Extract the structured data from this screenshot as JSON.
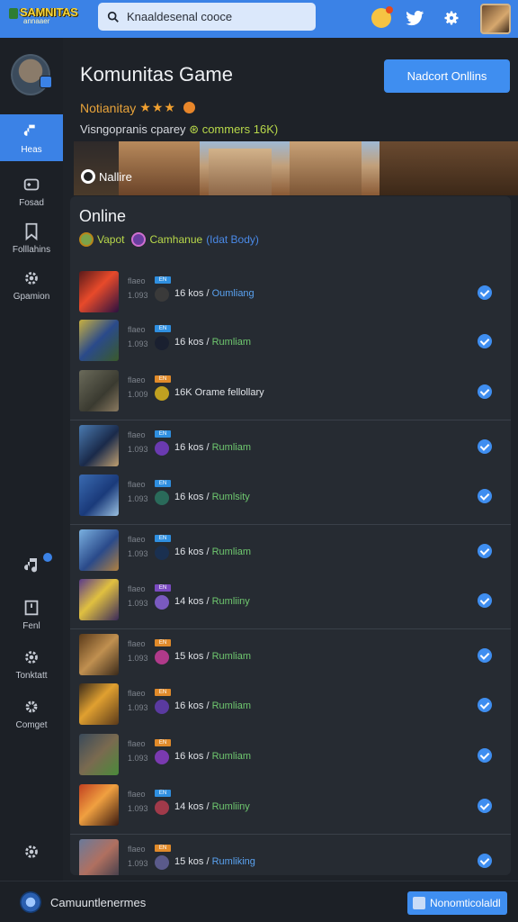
{
  "header": {
    "logo_text": "SAMNITAS",
    "logo_sub": "annaaer",
    "search_placeholder": "Knaaldesenal cooce"
  },
  "sidebar": {
    "items": [
      {
        "label": "Heas",
        "icon": "music-note-icon",
        "active": true
      },
      {
        "label": "Fosad",
        "icon": "controller-icon"
      },
      {
        "label": "Folllahins",
        "icon": "bookmark-icon"
      },
      {
        "label": "Gpamion",
        "icon": "gear-icon"
      },
      {
        "label": "Fenl",
        "icon": "square-icon"
      },
      {
        "label": "Tonktatt",
        "icon": "gear-icon"
      },
      {
        "label": "Comget",
        "icon": "cog-icon"
      }
    ]
  },
  "main": {
    "title": "Komunitas Game",
    "primary_button": "Nadcort Onllins",
    "rating_label": "Notianitay",
    "rating_stars": "★★★",
    "meta_text": "Visngopranis cparey",
    "meta_count": "⊛ commers 16K)",
    "banner_tag": "Nallire",
    "panel_title": "Online",
    "filter_a": "Vapot",
    "filter_b": "Camhanue",
    "filter_c": "(Idat Body)"
  },
  "list": [
    {
      "label": "flaeo",
      "num": "1.093",
      "badge": "EN",
      "badge_color": "#2f8fe0",
      "text": "16 kos /",
      "status": "Oumliang",
      "status_color": "#5aa2f0"
    },
    {
      "label": "flaeo",
      "num": "1.093",
      "badge": "EN",
      "badge_color": "#2f8fe0",
      "text": "16 kos /",
      "status": "Rumliam",
      "status_color": "#6fc86f"
    },
    {
      "label": "flaeo",
      "num": "1.009",
      "badge": "EN",
      "badge_color": "#e08a2a",
      "text": "16K Orame fellollary",
      "status": "",
      "status_color": "#6fc86f"
    },
    {
      "label": "flaeo",
      "num": "1.093",
      "badge": "EN",
      "badge_color": "#2f8fe0",
      "text": "16 kos /",
      "status": "Rumliam",
      "status_color": "#6fc86f"
    },
    {
      "label": "flaeo",
      "num": "1.093",
      "badge": "EN",
      "badge_color": "#2f8fe0",
      "text": "16 kos /",
      "status": "Rumlsity",
      "status_color": "#6fc86f"
    },
    {
      "label": "flaeo",
      "num": "1.093",
      "badge": "EN",
      "badge_color": "#2f8fe0",
      "text": "16 kos /",
      "status": "Rumliam",
      "status_color": "#6fc86f"
    },
    {
      "label": "flaeo",
      "num": "1.093",
      "badge": "EN",
      "badge_color": "#7a4ac0",
      "text": "14 kos /",
      "status": "Rumliiny",
      "status_color": "#6fc86f"
    },
    {
      "label": "flaeo",
      "num": "1.093",
      "badge": "EN",
      "badge_color": "#e08a2a",
      "text": "15 kos /",
      "status": "Rumliam",
      "status_color": "#6fc86f"
    },
    {
      "label": "flaeo",
      "num": "1.093",
      "badge": "EN",
      "badge_color": "#e08a2a",
      "text": "16 kos /",
      "status": "Rumliam",
      "status_color": "#6fc86f"
    },
    {
      "label": "flaeo",
      "num": "1.093",
      "badge": "EN",
      "badge_color": "#e08a2a",
      "text": "16 kos /",
      "status": "Rumliam",
      "status_color": "#6fc86f"
    },
    {
      "label": "flaeo",
      "num": "1.093",
      "badge": "EN",
      "badge_color": "#2f8fe0",
      "text": "14 kos /",
      "status": "Rumliiny",
      "status_color": "#6fc86f"
    },
    {
      "label": "flaeo",
      "num": "1.093",
      "badge": "EN",
      "badge_color": "#e08a2a",
      "text": "15 kos /",
      "status": "Rumliking",
      "status_color": "#5aa2f0"
    }
  ],
  "footer": {
    "text": "Camuuntlenermes",
    "button": "Nonomticolaldl"
  },
  "colors": {
    "accent": "#3b82e6",
    "check": "#3f8ef0",
    "status_green": "#6fc86f"
  }
}
